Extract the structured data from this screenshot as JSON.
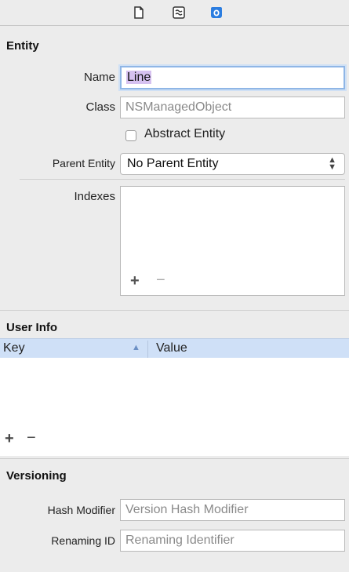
{
  "tabs": {
    "file_icon": "file-inspector-icon",
    "quickhelp_icon": "quick-help-icon",
    "model_icon": "data-model-inspector-icon"
  },
  "entity": {
    "heading": "Entity",
    "name_label": "Name",
    "name_value": "Line",
    "class_label": "Class",
    "class_placeholder": "NSManagedObject",
    "abstract_label": "Abstract Entity",
    "abstract_checked": false,
    "parent_label": "Parent Entity",
    "parent_value": "No Parent Entity",
    "indexes_label": "Indexes"
  },
  "user_info": {
    "heading": "User Info",
    "col_key": "Key",
    "col_value": "Value",
    "sort_indicator": "▲",
    "rows": []
  },
  "versioning": {
    "heading": "Versioning",
    "hash_label": "Hash Modifier",
    "hash_placeholder": "Version Hash Modifier",
    "renaming_label": "Renaming ID",
    "renaming_placeholder": "Renaming Identifier"
  },
  "colors": {
    "accent": "#2b7de0",
    "selection": "#d6c1f0",
    "header_blue": "#cfe0f7"
  }
}
